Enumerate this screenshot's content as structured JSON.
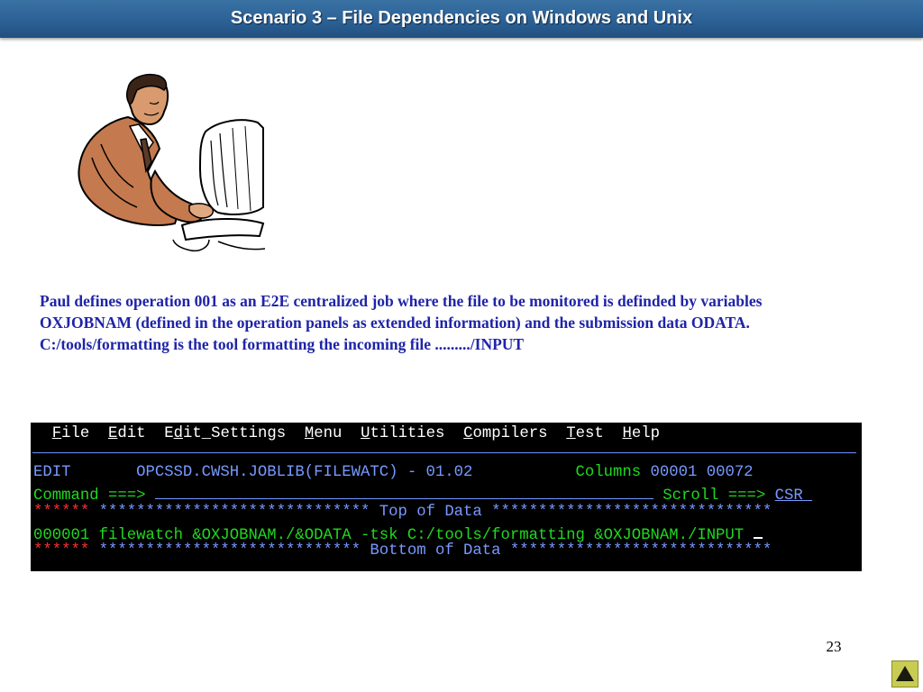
{
  "slide": {
    "title": "Scenario 3 – File Dependencies on Windows and Unix",
    "description": "Paul defines operation 001 as an E2E centralized job where the file to be monitored is definded by variables OXJOBNAM (defined in the operation panels as extended information) and the submission data ODATA.  C:/tools/formatting is the tool formatting the incoming file ........./INPUT",
    "page_number": "23"
  },
  "terminal": {
    "menu": [
      {
        "hot": "F",
        "rest": "ile"
      },
      {
        "pre": "",
        "hot": "E",
        "rest": "dit"
      },
      {
        "pre": "E",
        "hot": "d",
        "rest": "it_Settings"
      },
      {
        "pre": "",
        "hot": "M",
        "rest": "enu"
      },
      {
        "pre": "",
        "hot": "U",
        "rest": "tilities"
      },
      {
        "pre": "",
        "hot": "C",
        "rest": "ompilers"
      },
      {
        "pre": "",
        "hot": "T",
        "rest": "est"
      },
      {
        "pre": "",
        "hot": "H",
        "rest": "elp"
      }
    ],
    "edit_label": "EDIT",
    "dataset": "OPCSSD.CWSH.JOBLIB(FILEWATC) - 01.02",
    "columns_label": "Columns",
    "columns_from": "00001",
    "columns_to": "00072",
    "command_label": "Command ===>",
    "scroll_label": "Scroll ===>",
    "scroll_value": "CSR ",
    "top_prefix": "******",
    "top_line": "***************************** Top of Data ******************************",
    "line_number": "000001",
    "line_text": "filewatch &OXJOBNAM./&ODATA -tsk C:/tools/formatting &OXJOBNAM./INPUT",
    "bottom_prefix": "******",
    "bottom_line": "**************************** Bottom of Data ****************************"
  },
  "colors": {
    "title_bar": "#2c6196",
    "description_text": "#1f24a8",
    "terminal_bg": "#000000",
    "terminal_green": "#20d820",
    "terminal_blue": "#7799ff",
    "terminal_red": "#ff3030",
    "nav_button": "#c8cc52"
  },
  "icons": {
    "clipart": "man-at-computer-clipart",
    "nav": "up-triangle-icon"
  }
}
